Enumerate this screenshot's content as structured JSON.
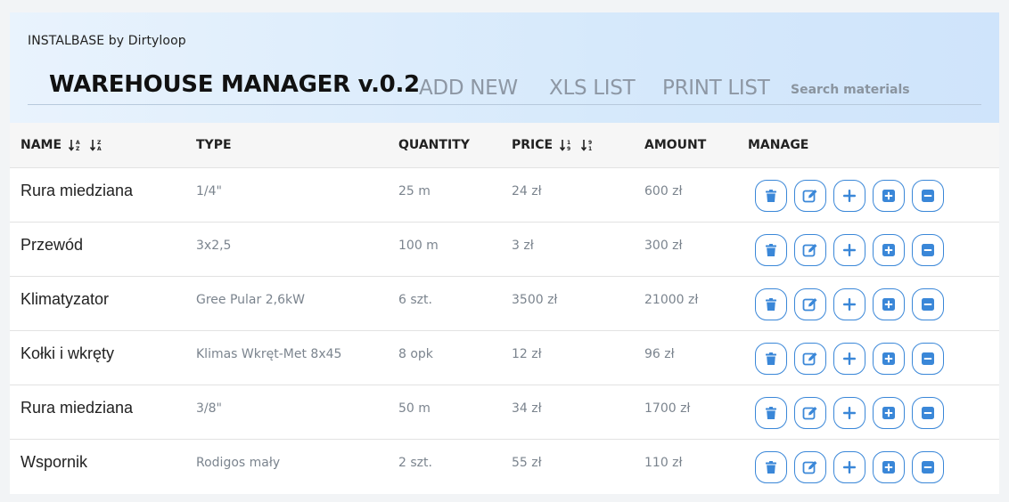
{
  "header": {
    "brand": "INSTALBASE by Dirtyloop",
    "title": "WAREHOUSE MANAGER v.0.2",
    "nav": [
      {
        "id": "add-new",
        "label": "ADD NEW"
      },
      {
        "id": "xls-list",
        "label": "XLS LIST"
      },
      {
        "id": "print-list",
        "label": "PRINT LIST"
      }
    ],
    "search": {
      "placeholder": "Search materials",
      "value": ""
    }
  },
  "table": {
    "columns": {
      "name": "NAME",
      "type": "TYPE",
      "quantity": "QUANTITY",
      "price": "PRICE",
      "amount": "AMOUNT",
      "manage": "MANAGE"
    },
    "rows": [
      {
        "name": "Rura miedziana",
        "type": "1/4\"",
        "quantity": "25 m",
        "price": "24 zł",
        "amount": "600 zł"
      },
      {
        "name": "Przewód",
        "type": "3x2,5",
        "quantity": "100 m",
        "price": "3 zł",
        "amount": "300 zł"
      },
      {
        "name": "Klimatyzator",
        "type": "Gree Pular 2,6kW",
        "quantity": "6 szt.",
        "price": "3500 zł",
        "amount": "21000 zł"
      },
      {
        "name": "Kołki i wkręty",
        "type": "Klimas Wkręt-Met 8x45",
        "quantity": "8 opk",
        "price": "12 zł",
        "amount": "96 zł"
      },
      {
        "name": "Rura miedziana",
        "type": "3/8\"",
        "quantity": "50 m",
        "price": "34 zł",
        "amount": "1700 zł"
      },
      {
        "name": "Wspornik",
        "type": "Rodigos mały",
        "quantity": "2 szt.",
        "price": "55 zł",
        "amount": "110 zł"
      }
    ],
    "actions": [
      {
        "id": "delete",
        "icon": "trash-icon"
      },
      {
        "id": "edit",
        "icon": "edit-icon"
      },
      {
        "id": "add",
        "icon": "plus-icon"
      },
      {
        "id": "increase",
        "icon": "plus-square-icon"
      },
      {
        "id": "decrease",
        "icon": "minus-square-icon"
      }
    ]
  },
  "colors": {
    "accent": "#3a87d8",
    "muted_text": "#7b848e",
    "nav_text": "#8d97a4"
  }
}
